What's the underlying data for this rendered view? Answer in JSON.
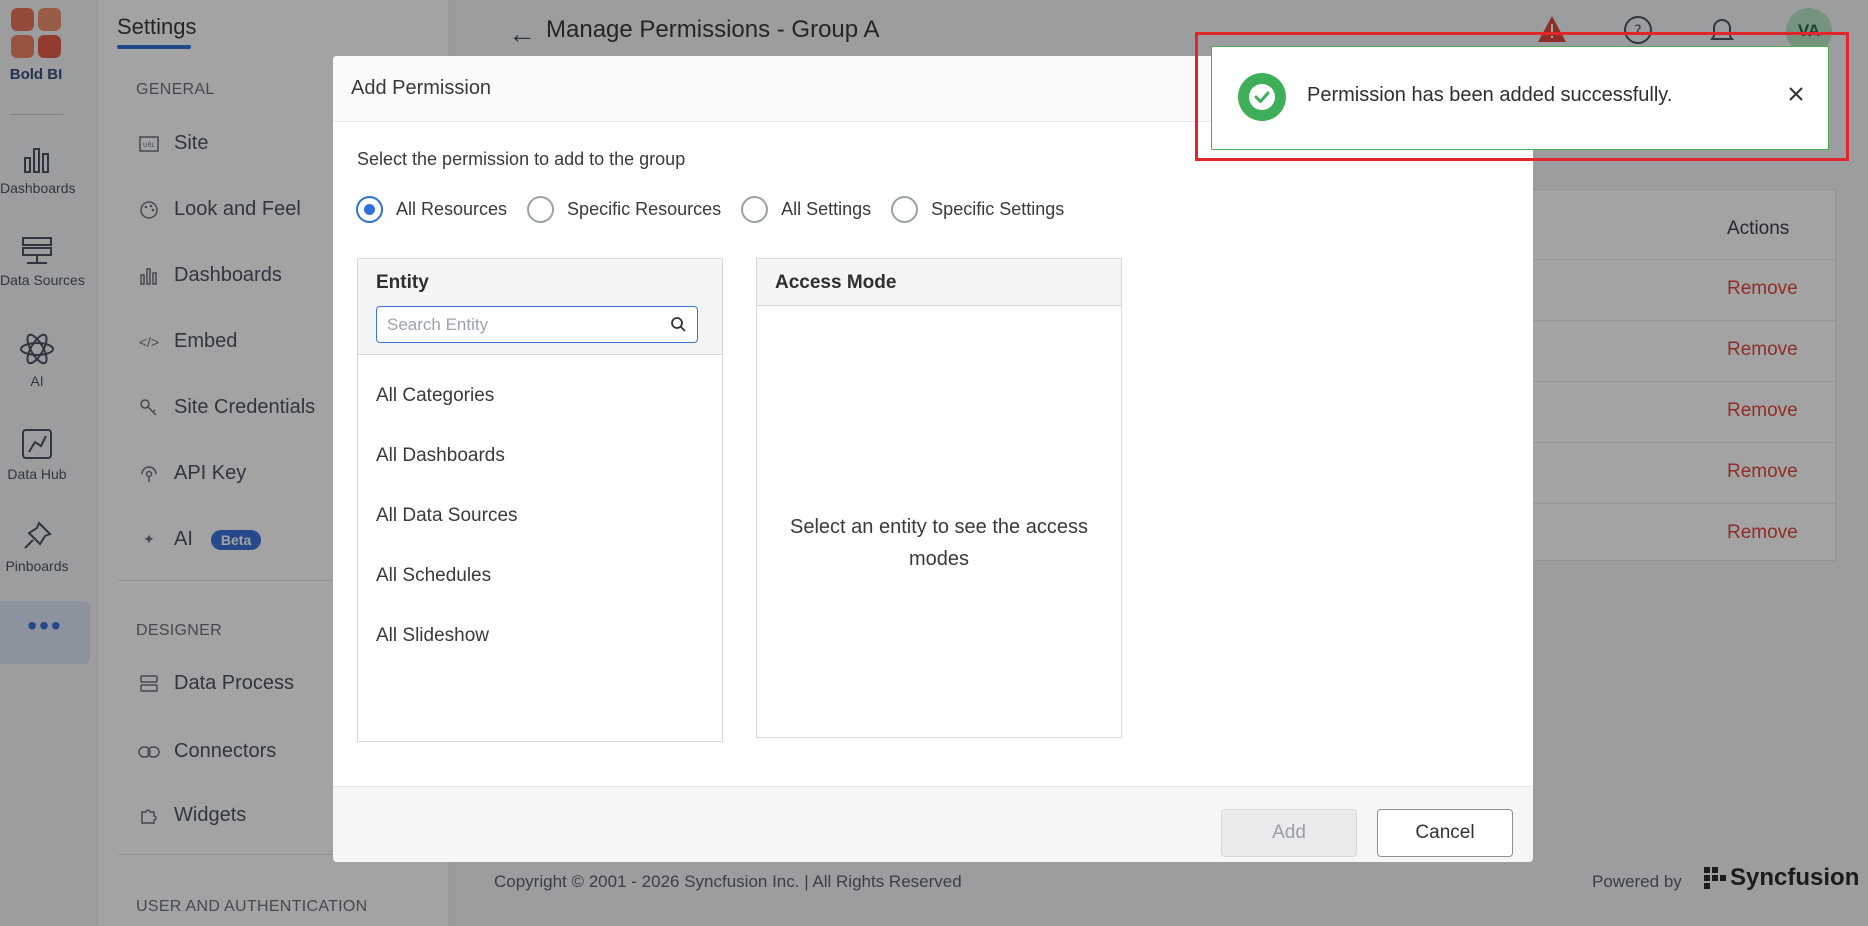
{
  "rail": {
    "brand": "Bold BI",
    "items": [
      {
        "label": "Dashboards",
        "icon": "bar-chart-icon"
      },
      {
        "label": "Data Sources",
        "icon": "data-sources-icon"
      },
      {
        "label": "AI",
        "icon": "atom-icon"
      },
      {
        "label": "Data Hub",
        "icon": "data-hub-icon"
      },
      {
        "label": "Pinboards",
        "icon": "pin-icon"
      }
    ],
    "more": "•••"
  },
  "settings": {
    "title": "Settings",
    "general_heading": "GENERAL",
    "general_items": [
      {
        "label": "Site",
        "icon": "url-icon"
      },
      {
        "label": "Look and Feel",
        "icon": "palette-icon"
      },
      {
        "label": "Dashboards",
        "icon": "bar-chart-icon"
      },
      {
        "label": "Embed",
        "icon": "code-icon"
      },
      {
        "label": "Site Credentials",
        "icon": "key-icon"
      },
      {
        "label": "API Key",
        "icon": "api-key-icon"
      },
      {
        "label": "AI",
        "icon": "sparkle-icon",
        "badge": "Beta"
      }
    ],
    "designer_heading": "DESIGNER",
    "designer_items": [
      {
        "label": "Data Process",
        "icon": "data-process-icon"
      },
      {
        "label": "Connectors",
        "icon": "link-icon"
      },
      {
        "label": "Widgets",
        "icon": "puzzle-icon"
      }
    ],
    "user_heading": "USER AND AUTHENTICATION"
  },
  "header": {
    "title": "Manage Permissions - Group A",
    "avatar_initials": "VA"
  },
  "table": {
    "actions_header": "Actions",
    "remove_label": "Remove"
  },
  "footer": {
    "copyright": "Copyright © 2001 - 2026 Syncfusion Inc.   |   All Rights Reserved",
    "powered_by": "Powered by",
    "brand": "Syncfusion"
  },
  "dialog": {
    "title": "Add Permission",
    "instruction": "Select the permission to add to the group",
    "options": [
      {
        "label": "All Resources",
        "checked": true
      },
      {
        "label": "Specific Resources",
        "checked": false
      },
      {
        "label": "All Settings",
        "checked": false
      },
      {
        "label": "Specific Settings",
        "checked": false
      }
    ],
    "entity": {
      "title": "Entity",
      "search_placeholder": "Search Entity",
      "items": [
        "All Categories",
        "All Dashboards",
        "All Data Sources",
        "All Schedules",
        "All Slideshow"
      ]
    },
    "access": {
      "title": "Access Mode",
      "empty_message": "Select an entity to see the access modes"
    },
    "add_label": "Add",
    "cancel_label": "Cancel"
  },
  "toast": {
    "message": "Permission has been added successfully.",
    "status": "success"
  },
  "colors": {
    "accent": "#2f6fdc",
    "success": "#3fae58",
    "danger": "#e0483e",
    "highlight": "#e0262a"
  }
}
